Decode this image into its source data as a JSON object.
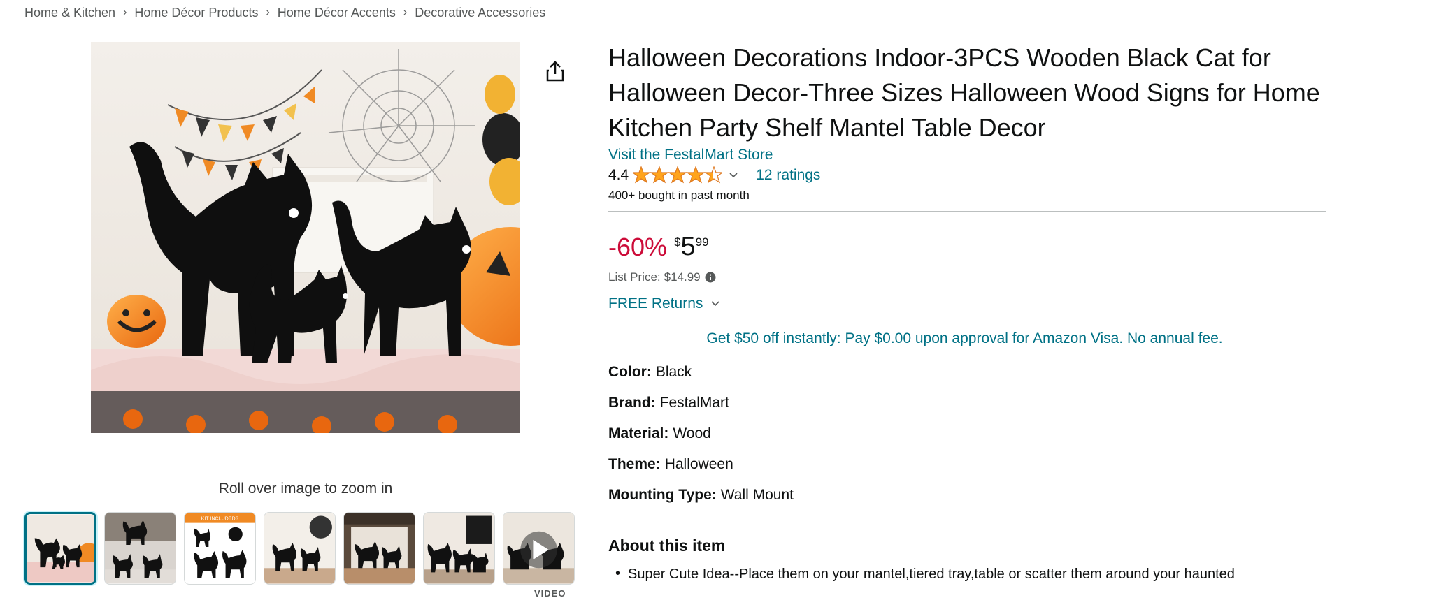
{
  "breadcrumb": [
    "Home & Kitchen",
    "Home Décor Products",
    "Home Décor Accents",
    "Decorative Accessories"
  ],
  "breadcrumb_separator": "›",
  "product": {
    "title": "Halloween Decorations Indoor-3PCS Wooden Black Cat for Halloween Decor-Three Sizes Halloween Wood Signs for Home Kitchen Party Shelf Mantel Table Decor",
    "store_link": "Visit the FestalMart Store",
    "rating_value": "4.4",
    "rating_stars": 4.4,
    "ratings_count": "12 ratings",
    "bought": "400+ bought in past month",
    "discount": "-60%",
    "price_symbol": "$",
    "price_whole": "5",
    "price_fraction": "99",
    "list_price_label": "List Price:",
    "list_price_value": "$14.99",
    "returns": "FREE Returns",
    "promo": "Get $50 off instantly: Pay $0.00 upon approval for Amazon Visa. No annual fee."
  },
  "specs": [
    {
      "label": "Color:",
      "value": "Black"
    },
    {
      "label": "Brand:",
      "value": "FestalMart"
    },
    {
      "label": "Material:",
      "value": "Wood"
    },
    {
      "label": "Theme:",
      "value": "Halloween"
    },
    {
      "label": "Mounting Type:",
      "value": "Wall Mount"
    }
  ],
  "about": {
    "title": "About this item",
    "bullets": [
      "Super Cute Idea--Place them on your mantel,tiered tray,table or scatter them around your haunted"
    ]
  },
  "gallery": {
    "zoom_hint": "Roll over image to zoom in",
    "video_label": "VIDEO",
    "thumbnails": [
      "thumb-1",
      "thumb-2",
      "thumb-3",
      "thumb-4",
      "thumb-5",
      "thumb-6",
      "thumb-video"
    ],
    "thumb3_text": "KIT INCLUDEDS"
  },
  "colors": {
    "link": "#007185",
    "discount": "#cc0c39",
    "star": "#ffa41c",
    "active_thumb": "#007185"
  },
  "icons": {
    "share": "share-icon",
    "star": "star-icon",
    "chevron": "chevron-down-icon",
    "info": "info-icon",
    "play": "play-icon"
  }
}
